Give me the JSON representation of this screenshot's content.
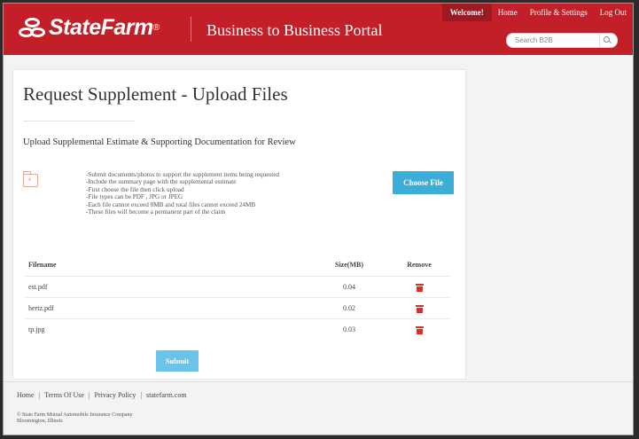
{
  "header": {
    "brand": "StateFarm",
    "brand_mark": "®",
    "portal_title": "Business to Business Portal",
    "nav": {
      "welcome": "Welcome!",
      "home": "Home",
      "profile": "Profile & Settings",
      "logout": "Log Out"
    },
    "search_placeholder": "Search B2B",
    "colors": {
      "brand_red": "#c21f28",
      "accent_blue": "#3aaed8"
    }
  },
  "main": {
    "title": "Request Supplement - Upload Files",
    "subtitle": "Upload Supplemental Estimate & Supporting Documentation for Review",
    "instructions": [
      "-Submit documents/photos to support the supplement items being requested",
      "-Include the summary page with the supplemental estimate",
      "-First choose the file then click upload",
      "-File types can be PDF , JPG or JPEG",
      "-Each file cannot exceed 8MB and total files cannot exceed 24MB",
      "-These files will become a permanent part of the claim"
    ],
    "choose_file_label": "Choose File",
    "table": {
      "headers": {
        "filename": "Filename",
        "size": "Size(MB)",
        "remove": "Remove"
      },
      "rows": [
        {
          "filename": "est.pdf",
          "size": "0.04"
        },
        {
          "filename": "hertz.pdf",
          "size": "0.02"
        },
        {
          "filename": "tp.jpg",
          "size": "0.03"
        }
      ]
    },
    "submit_label": "Submit"
  },
  "footer": {
    "links": [
      "Home",
      "Terms Of Use",
      "Privacy Policy",
      "statefarm.com"
    ],
    "copyright": [
      "© State Farm Mutual Automobile Insurance Company",
      "Bloomington, Illinois"
    ]
  }
}
